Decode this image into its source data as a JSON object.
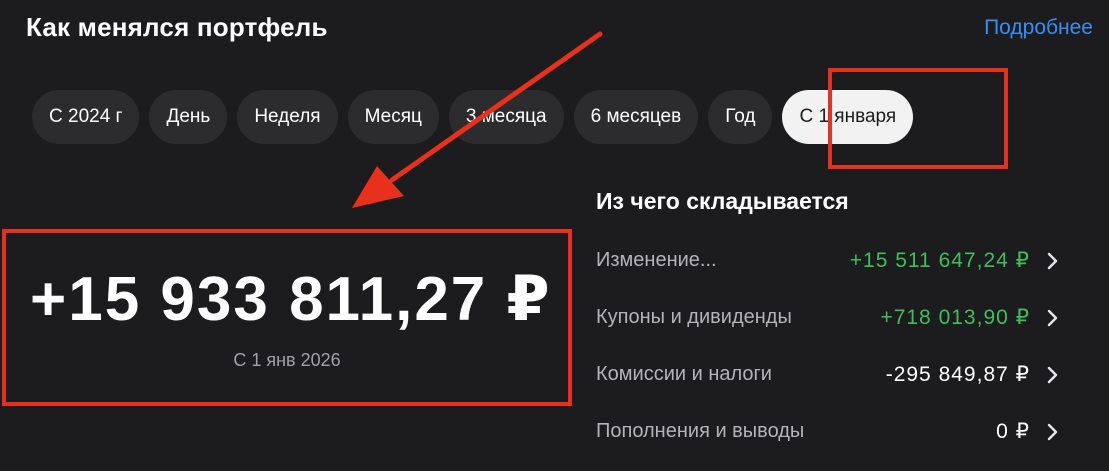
{
  "header": {
    "title": "Как менялся портфель",
    "more_link": "Подробнее"
  },
  "period_tabs": [
    {
      "label": "С 2024 г",
      "active": false
    },
    {
      "label": "День",
      "active": false
    },
    {
      "label": "Неделя",
      "active": false
    },
    {
      "label": "Месяц",
      "active": false
    },
    {
      "label": "3 месяца",
      "active": false
    },
    {
      "label": "6 месяцев",
      "active": false
    },
    {
      "label": "Год",
      "active": false
    },
    {
      "label": "С 1 января",
      "active": true
    }
  ],
  "summary": {
    "amount": "+15 933 811,27 ₽",
    "period_caption": "С 1 янв 2026"
  },
  "breakdown": {
    "title": "Из чего складывается",
    "rows": [
      {
        "label": "Изменение...",
        "value": "+15 511 647,24 ₽",
        "tone": "pos"
      },
      {
        "label": "Купоны и дивиденды",
        "value": "+718 013,90 ₽",
        "tone": "pos"
      },
      {
        "label": "Комиссии и налоги",
        "value": "-295 849,87 ₽",
        "tone": "neutral"
      },
      {
        "label": "Пополнения и выводы",
        "value": "0 ₽",
        "tone": "neutral"
      }
    ]
  },
  "colors": {
    "background": "#1c1c1e",
    "accent_link": "#3b8ef0",
    "positive": "#3fbf5a",
    "annotation_red": "#e8301c",
    "pill_bg": "#2c2c2e",
    "pill_active_bg": "#f2f2f2"
  },
  "icons": {
    "row_chevron": "chevron-right-icon",
    "annotation": "red-arrow-annotation"
  }
}
